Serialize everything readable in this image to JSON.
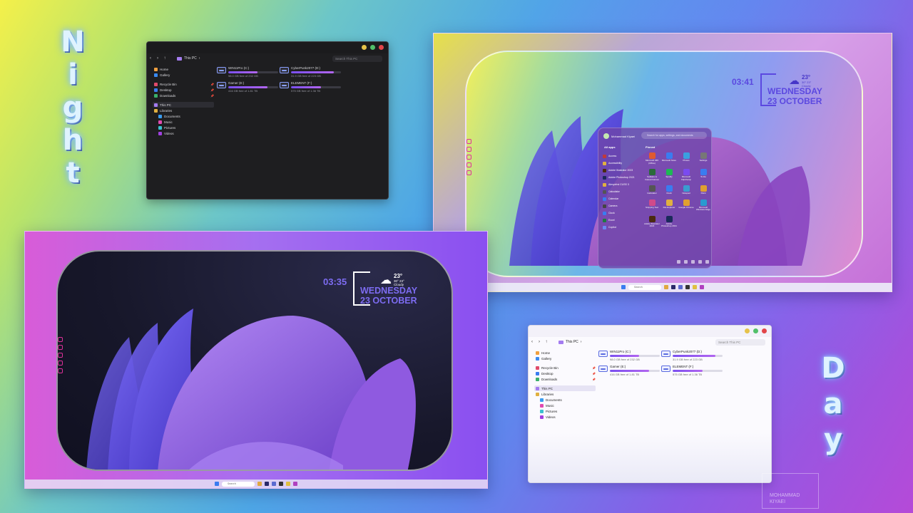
{
  "labels": {
    "night": [
      "N",
      "i",
      "g",
      "h",
      "t"
    ],
    "day": [
      "D",
      "a",
      "y"
    ]
  },
  "colors": {
    "accent_purple": "#8a5cf0",
    "clock_night": "#7d6cf2",
    "clock_day": "#5b48e0"
  },
  "explorer": {
    "breadcrumb": "This PC",
    "search_placeholder": "Search This PC",
    "sidebar": [
      {
        "label": "Home",
        "icon": "home-icon"
      },
      {
        "label": "Gallery",
        "icon": "gallery-icon"
      },
      {
        "label": "Recycle Bin",
        "icon": "recycle-bin-icon",
        "pinned": true
      },
      {
        "label": "Desktop",
        "icon": "desktop-icon",
        "pinned": true
      },
      {
        "label": "Downloads",
        "icon": "downloads-icon",
        "pinned": true
      },
      {
        "label": "This PC",
        "icon": "this-pc-icon"
      },
      {
        "label": "Libraries",
        "icon": "libraries-icon"
      },
      {
        "label": "Documents",
        "icon": "documents-icon"
      },
      {
        "label": "Music",
        "icon": "music-icon"
      },
      {
        "label": "Pictures",
        "icon": "pictures-icon"
      },
      {
        "label": "Videos",
        "icon": "videos-icon"
      }
    ],
    "drives_night": [
      {
        "name": "WIN11Pro (C:)",
        "free": "98.0 GB free of 232 GB",
        "used_fraction": 0.58
      },
      {
        "name": "CyberPunk2077 (D:)",
        "free": "31.9 GB free of 223 GB",
        "used_fraction": 0.86
      },
      {
        "name": "Gamer (E:)",
        "free": "416 GB free of 1.81 TB",
        "used_fraction": 0.78
      },
      {
        "name": "ELEMENT (F:)",
        "free": "575 GB free of 1.36 TB",
        "used_fraction": 0.6
      }
    ],
    "drives_day": [
      {
        "name": "WIN11Pro (C:)",
        "free": "98.0 GB free of 232 GB",
        "used_fraction": 0.58
      },
      {
        "name": "CyberPunk2077 (D:)",
        "free": "31.9 GB free of 223 GB",
        "used_fraction": 0.86
      },
      {
        "name": "Gamer (E:)",
        "free": "416 GB free of 1.81 TB",
        "used_fraction": 0.78
      },
      {
        "name": "ELEMENT (F:)",
        "free": "575 GB free of 1.36 TB",
        "used_fraction": 0.6
      }
    ]
  },
  "night_desktop": {
    "time": "03:35",
    "day": "WEDNESDAY",
    "date": "23 OCTOBER",
    "temp": "23°",
    "range": "30° 23°",
    "condition": "Cloudy",
    "search": "Search"
  },
  "day_desktop": {
    "time": "03:41",
    "day": "WEDNESDAY",
    "date": "23 OCTOBER",
    "temp": "23°",
    "range": "30° 23°",
    "condition": "Cloudy",
    "search": "Search"
  },
  "start_menu": {
    "user": "Mohammad Kiyaei",
    "search_placeholder": "Search for apps, settings, and documents",
    "all_apps": "All apps",
    "pinned": "Pinned",
    "apps": [
      {
        "label": "Access",
        "icon": "access-icon"
      },
      {
        "label": "Accessibility",
        "icon": "folder-icon"
      },
      {
        "label": "Adobe Illustrator 2023",
        "icon": "illustrator-icon"
      },
      {
        "label": "Adobe Photoshop 2021",
        "icon": "photoshop-icon"
      },
      {
        "label": "Alexyxfrst CUSS 3",
        "icon": "folder-icon"
      },
      {
        "label": "Calculator",
        "icon": "calculator-icon"
      },
      {
        "label": "Calendar",
        "icon": "calendar-icon"
      },
      {
        "label": "Camera",
        "icon": "camera-icon"
      },
      {
        "label": "Clock",
        "icon": "clock-icon"
      },
      {
        "label": "Excel",
        "icon": "excel-icon"
      },
      {
        "label": "Copilot",
        "icon": "copilot-icon"
      }
    ],
    "pinned_apps": [
      {
        "label": "Microsoft 365 (Office)",
        "icon": "office-icon"
      },
      {
        "label": "Microsoft Store",
        "icon": "store-icon"
      },
      {
        "label": "Photos",
        "icon": "photos-icon"
      },
      {
        "label": "Settings",
        "icon": "settings-icon"
      },
      {
        "label": "Solitaire & Casual Games",
        "icon": "solitaire-icon"
      },
      {
        "label": "Spotify",
        "icon": "spotify-icon"
      },
      {
        "label": "Microsoft Clipchamp",
        "icon": "clipchamp-icon"
      },
      {
        "label": "To Do",
        "icon": "todo-icon"
      },
      {
        "label": "Calculator",
        "icon": "calculator-icon"
      },
      {
        "label": "Clock",
        "icon": "clock-icon"
      },
      {
        "label": "Notepad",
        "icon": "notepad-icon"
      },
      {
        "label": "Paint",
        "icon": "paint-icon"
      },
      {
        "label": "Snipping Tool",
        "icon": "snipping-icon"
      },
      {
        "label": "File Explorer",
        "icon": "folder-icon"
      },
      {
        "label": "Google Chrome",
        "icon": "chrome-icon"
      },
      {
        "label": "Microsoft Windows Edge",
        "icon": "edge-icon"
      },
      {
        "label": "Adobe Illustrator 2023",
        "icon": "illustrator-icon"
      },
      {
        "label": "Adobe Photoshop 2021",
        "icon": "photoshop-icon"
      }
    ]
  },
  "watermark": [
    "MOHAMMAD",
    "KIYAEI"
  ]
}
